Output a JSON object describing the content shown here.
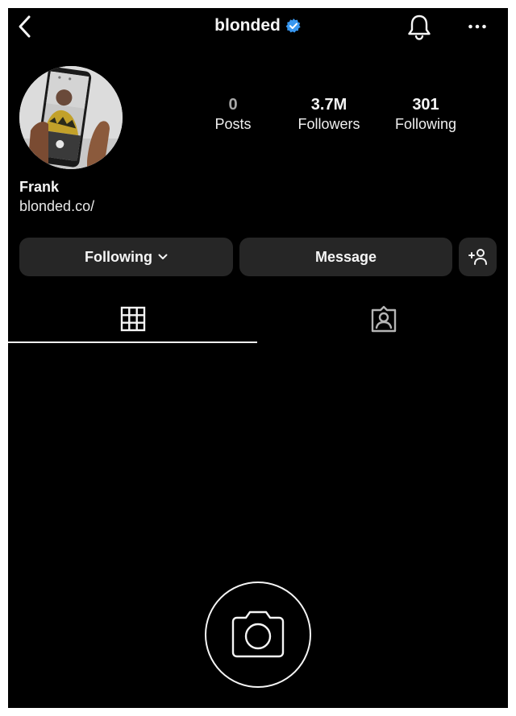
{
  "header": {
    "username": "blonded",
    "icons": {
      "back": "chevron-left-icon",
      "verified": "verified-badge-icon",
      "notifications": "bell-icon",
      "more": "more-horizontal-icon"
    },
    "colors": {
      "verified": "#3897f0",
      "background": "#000000"
    }
  },
  "profile": {
    "display_name": "Frank",
    "website": "blonded.co/",
    "stats": [
      {
        "value": "0",
        "label": "Posts"
      },
      {
        "value": "3.7M",
        "label": "Followers"
      },
      {
        "value": "301",
        "label": "Following"
      }
    ]
  },
  "actions": {
    "following_label": "Following",
    "message_label": "Message",
    "add_user_icon": "add-user-icon"
  },
  "tabs": {
    "grid_icon": "grid-icon",
    "tagged_icon": "tagged-person-icon",
    "active": "grid"
  },
  "empty_state": {
    "icon": "camera-icon"
  }
}
